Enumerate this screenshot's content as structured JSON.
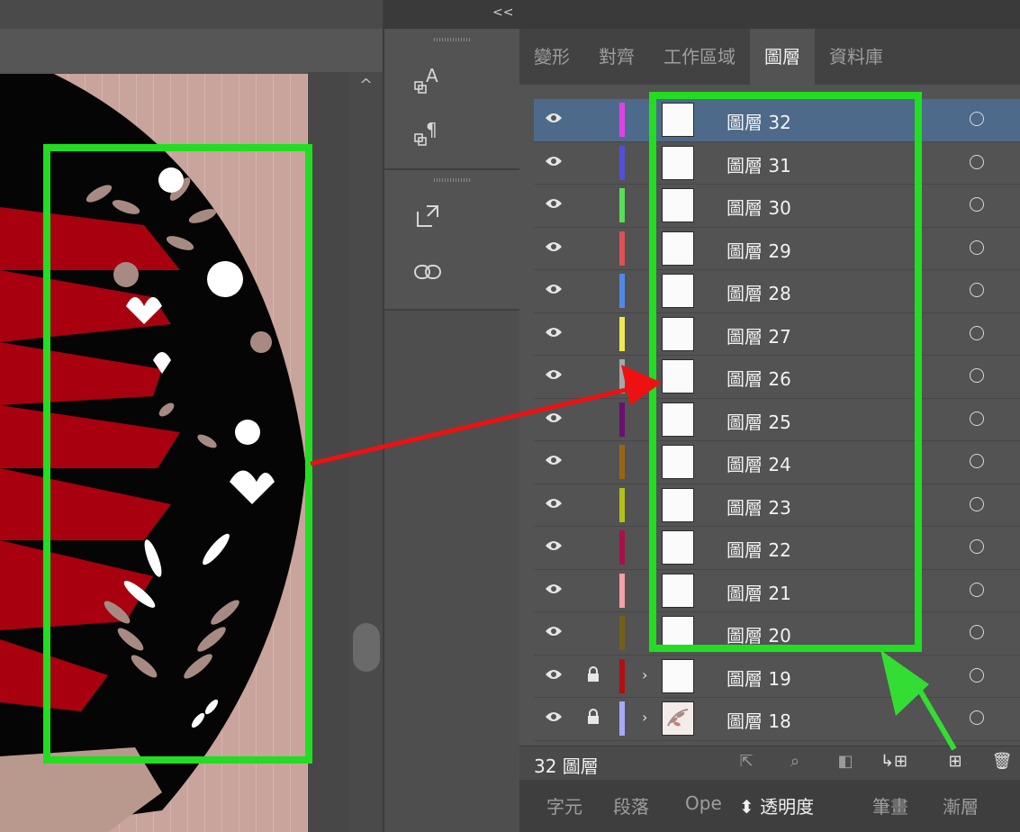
{
  "canvas": {
    "scroll_up_glyph": "^",
    "colors": {
      "artboard": "#c8a49c",
      "disc": "#050505",
      "brush": "#a90010",
      "leaf_brown": "#a78b82",
      "white": "#ffffff"
    }
  },
  "toolbar": {
    "collapse_glyph": "<<",
    "tools": [
      {
        "name": "character-styles-icon"
      },
      {
        "name": "paragraph-styles-icon"
      },
      {
        "name": "export-icon"
      },
      {
        "name": "links-icon"
      }
    ]
  },
  "panel": {
    "tabs": [
      {
        "label": "變形",
        "active": false
      },
      {
        "label": "對齊",
        "active": false
      },
      {
        "label": "工作區域",
        "active": false
      },
      {
        "label": "圖層",
        "active": true
      },
      {
        "label": "資料庫",
        "active": false
      }
    ],
    "layers": [
      {
        "name": "圖層 32",
        "color": "#e040e8",
        "selected": true,
        "locked": false,
        "expandable": false,
        "thumb": "blank"
      },
      {
        "name": "圖層 31",
        "color": "#5050d8",
        "selected": false,
        "locked": false,
        "expandable": false,
        "thumb": "blank"
      },
      {
        "name": "圖層 30",
        "color": "#58e058",
        "selected": false,
        "locked": false,
        "expandable": false,
        "thumb": "blank"
      },
      {
        "name": "圖層 29",
        "color": "#e05050",
        "selected": false,
        "locked": false,
        "expandable": false,
        "thumb": "blank"
      },
      {
        "name": "圖層 28",
        "color": "#5088e8",
        "selected": false,
        "locked": false,
        "expandable": false,
        "thumb": "blank"
      },
      {
        "name": "圖層 27",
        "color": "#f0e850",
        "selected": false,
        "locked": false,
        "expandable": false,
        "thumb": "blank"
      },
      {
        "name": "圖層 26",
        "color": "#a8a8a8",
        "selected": false,
        "locked": false,
        "expandable": false,
        "thumb": "blank"
      },
      {
        "name": "圖層 25",
        "color": "#6a0f70",
        "selected": false,
        "locked": false,
        "expandable": false,
        "thumb": "blank"
      },
      {
        "name": "圖層 24",
        "color": "#9a6418",
        "selected": false,
        "locked": false,
        "expandable": false,
        "thumb": "blank"
      },
      {
        "name": "圖層 23",
        "color": "#b2c018",
        "selected": false,
        "locked": false,
        "expandable": false,
        "thumb": "blank"
      },
      {
        "name": "圖層 22",
        "color": "#a8104a",
        "selected": false,
        "locked": false,
        "expandable": false,
        "thumb": "blank"
      },
      {
        "name": "圖層 21",
        "color": "#f4a0a4",
        "selected": false,
        "locked": false,
        "expandable": false,
        "thumb": "blank"
      },
      {
        "name": "圖層 20",
        "color": "#746018",
        "selected": false,
        "locked": false,
        "expandable": false,
        "thumb": "blank"
      },
      {
        "name": "圖層 19",
        "color": "#b01010",
        "selected": false,
        "locked": true,
        "expandable": true,
        "thumb": "blank"
      },
      {
        "name": "圖層 18",
        "color": "#a8a8f8",
        "selected": false,
        "locked": true,
        "expandable": true,
        "thumb": "art"
      },
      {
        "name": "",
        "color": "#e080b0",
        "selected": false,
        "locked": false,
        "expandable": false,
        "thumb": "art"
      }
    ],
    "footer": {
      "count_label": "32 圖層",
      "buttons": [
        {
          "name": "export-to-screen-icon",
          "glyph": "⇱"
        },
        {
          "name": "locate-object-icon",
          "glyph": "⌕"
        },
        {
          "name": "clipping-mask-icon",
          "glyph": "◧"
        },
        {
          "name": "create-sublayer-icon",
          "glyph": "↳⊞"
        },
        {
          "name": "new-layer-icon",
          "glyph": "⊞"
        },
        {
          "name": "delete-layer-icon",
          "glyph": "🗑"
        }
      ]
    },
    "bottom_tabs": [
      {
        "label": "字元",
        "active": false
      },
      {
        "label": "段落",
        "active": false
      },
      {
        "label": "Ope",
        "active": false
      },
      {
        "label": "⬍ 透明度",
        "active": true
      },
      {
        "label": "筆畫",
        "active": false
      },
      {
        "label": "漸層",
        "active": false
      }
    ]
  },
  "annotations": {
    "highlight_color": "#22dd22",
    "arrow_red": "#ee1111",
    "arrow_green": "#33dd33"
  }
}
